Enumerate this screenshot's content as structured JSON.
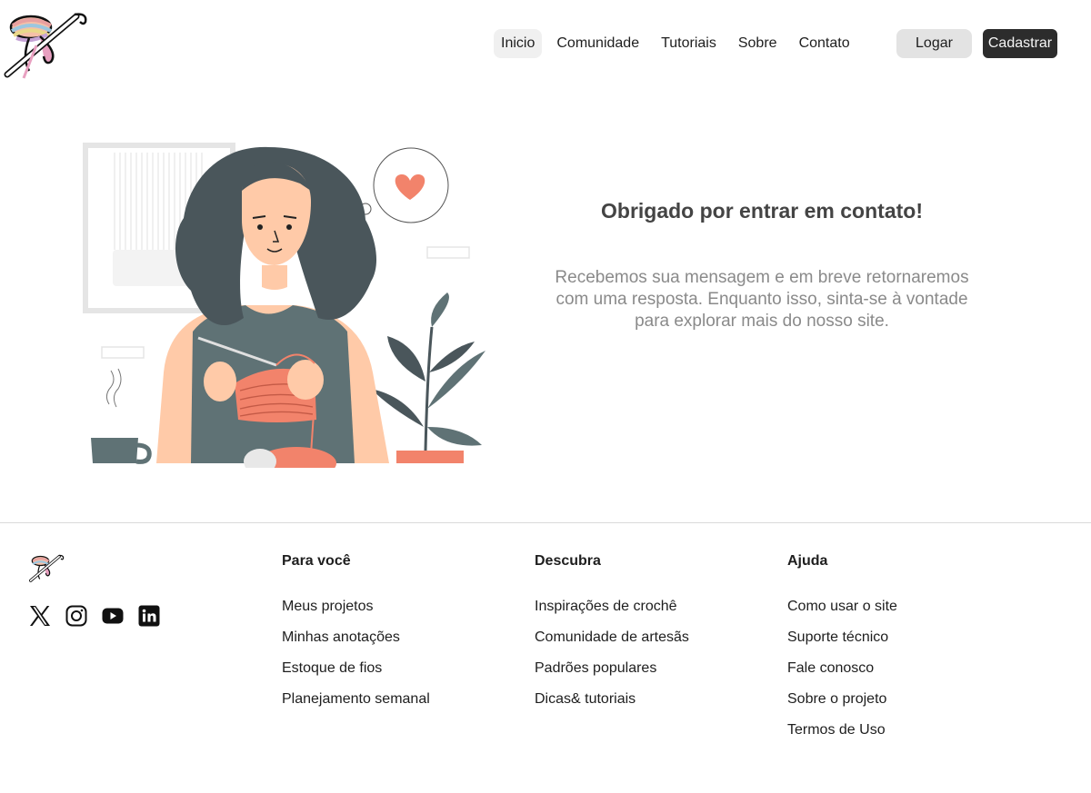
{
  "header": {
    "nav": [
      "Inicio",
      "Comunidade",
      "Tutoriais",
      "Sobre",
      "Contato"
    ],
    "active_nav": "Inicio",
    "login_label": "Logar",
    "signup_label": "Cadastrar"
  },
  "main": {
    "title": "Obrigado por entrar em contato!",
    "message": "Recebemos sua mensagem e em breve retornaremos com uma resposta. Enquanto isso, sinta-se à vontade para explorar mais do nosso site."
  },
  "footer": {
    "socials": [
      "x-icon",
      "instagram-icon",
      "youtube-icon",
      "linkedin-icon"
    ],
    "columns": [
      {
        "title": "Para você",
        "links": [
          "Meus projetos",
          "Minhas anotações",
          "Estoque de fios",
          "Planejamento semanal"
        ]
      },
      {
        "title": "Descubra",
        "links": [
          "Inspirações de crochê",
          "Comunidade de artesãs",
          "Padrões populares",
          "Dicas& tutoriais"
        ]
      },
      {
        "title": "Ajuda",
        "links": [
          "Como usar o site",
          "Suporte técnico",
          "Fale conosco",
          "Sobre o projeto",
          "Termos de Uso"
        ]
      }
    ]
  },
  "colors": {
    "accent": "#f2836b",
    "dark_button": "#2c2c2c",
    "hair": "#4a565b",
    "shirt": "#5f7275"
  }
}
